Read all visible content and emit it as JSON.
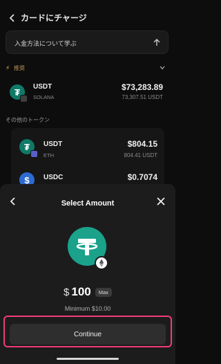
{
  "header": {
    "title": "カードにチャージ"
  },
  "learn": {
    "label": "入金方法について学ぶ"
  },
  "recommended": {
    "label": "推奨"
  },
  "tokens": [
    {
      "symbol": "USDT",
      "network": "SOLANA",
      "amount": "$73,283.89",
      "usd": "73,307.51 USDT"
    },
    {
      "symbol": "USDT",
      "network": "ETH",
      "amount": "$804.15",
      "usd": "804.41 USDT"
    },
    {
      "symbol": "USDC",
      "network": "",
      "amount": "$0.7074",
      "usd": ""
    }
  ],
  "other_tokens_label": "その他のトークン",
  "sheet": {
    "title": "Select Amount",
    "currency_symbol": "$",
    "amount": "100",
    "max_label": "Max",
    "minimum": "Minimum $10.00",
    "continue_label": "Continue"
  },
  "colors": {
    "highlight": "#f23c7a",
    "tether": "#1aa28b",
    "accent_bolt": "#f5b84c"
  }
}
